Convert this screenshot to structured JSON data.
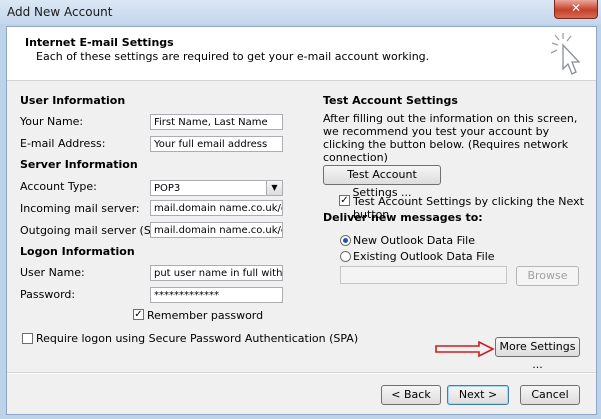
{
  "window": {
    "title": "Add New Account",
    "close_icon": "✕"
  },
  "header": {
    "title": "Internet E-mail Settings",
    "subtitle": "Each of these settings are required to get your e-mail account working."
  },
  "user_info": {
    "heading": "User Information",
    "name_label": "Your Name:",
    "name_value": "First Name, Last Name",
    "email_label": "E-mail Address:",
    "email_value": "Your full email address"
  },
  "server_info": {
    "heading": "Server Information",
    "account_type_label": "Account Type:",
    "account_type_value": "POP3",
    "incoming_label": "Incoming mail server:",
    "incoming_value": "mail.domain name.co.uk/com",
    "outgoing_label": "Outgoing mail server (SMTP):",
    "outgoing_value": "mail.domain name.co.uk/com"
  },
  "logon_info": {
    "heading": "Logon Information",
    "username_label": "User Name:",
    "username_value": "put user name in full with +",
    "password_label": "Password:",
    "password_value": "*************",
    "remember_label": "Remember password",
    "remember_checked": true,
    "spa_label": "Require logon using Secure Password Authentication (SPA)",
    "spa_checked": false
  },
  "test_settings": {
    "heading": "Test Account Settings",
    "description": "After filling out the information on this screen, we recommend you test your account by clicking the button below. (Requires network connection)",
    "test_button": "Test Account Settings ...",
    "test_next_label": "Test Account Settings by clicking the Next button",
    "test_next_checked": true
  },
  "deliver": {
    "heading": "Deliver new messages to:",
    "option_new": "New Outlook Data File",
    "option_existing": "Existing Outlook Data File",
    "selected": "new",
    "browse_button": "Browse"
  },
  "more_settings_button": "More Settings ...",
  "footer": {
    "back": "< Back",
    "next": "Next >",
    "cancel": "Cancel"
  },
  "colors": {
    "arrow": "#cc1f1f",
    "accent": "#3c7fb1"
  }
}
